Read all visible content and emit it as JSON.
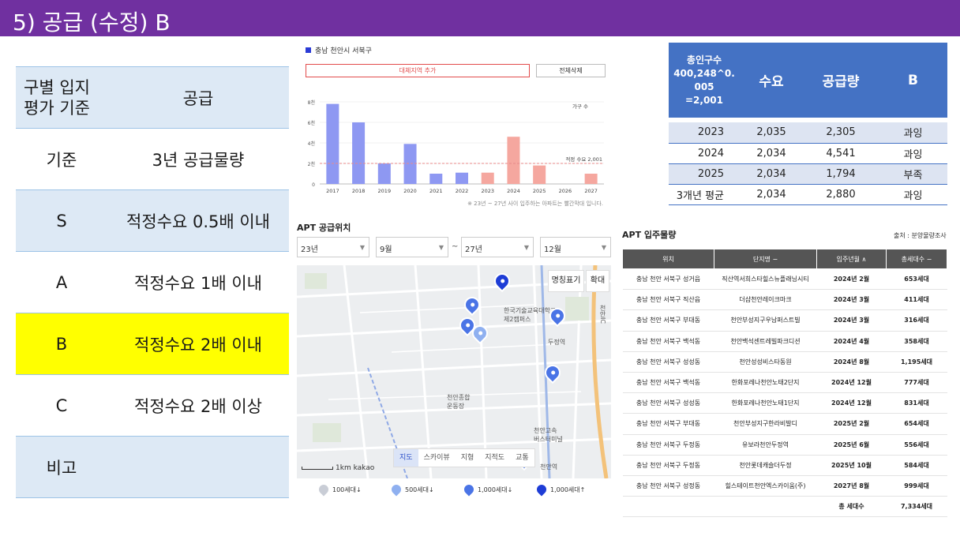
{
  "title": "5) 공급 (수정) B",
  "criteria": {
    "header": [
      "구별 입지\n평가 기준",
      "공급"
    ],
    "rows": [
      {
        "label": "기준",
        "value": "3년 공급물량"
      },
      {
        "label": "S",
        "value": "적정수요 0.5배 이내"
      },
      {
        "label": "A",
        "value": "적정수요 1배 이내"
      },
      {
        "label": "B",
        "value": "적정수요 2배 이내"
      },
      {
        "label": "C",
        "value": "적정수요 2배 이상"
      },
      {
        "label": "비고",
        "value": ""
      }
    ]
  },
  "chart_panel": {
    "region": "충남 천안시 서북구",
    "add_button": "대체지역 추가",
    "delete_button": "전체삭제",
    "note": "※ 23년 ~ 27년 사이 입주하는 아파트는 빨간막대 입니다."
  },
  "chart_data": {
    "type": "bar",
    "categories": [
      "2017",
      "2018",
      "2019",
      "2020",
      "2021",
      "2022",
      "2023",
      "2024",
      "2025",
      "2026",
      "2027"
    ],
    "values": [
      7800,
      6000,
      2000,
      3900,
      1000,
      1100,
      1100,
      4600,
      1800,
      0,
      1000
    ],
    "ylim": [
      0,
      8000
    ],
    "yticks": [
      "0",
      "2천",
      "4천",
      "6천",
      "8천"
    ],
    "legend": "가구 수",
    "reference_line": {
      "value": 2001,
      "label": "적정 수요 2,001"
    },
    "colors": {
      "past": "#8e98f2",
      "future": "#f5a79f",
      "ref": "#e88a8a"
    }
  },
  "map_panel": {
    "title": "APT 공급위치",
    "selects": [
      "23년",
      "9월",
      "27년",
      "12월"
    ],
    "tilde": "~",
    "buttons": {
      "names": "명칭표기",
      "zoom": "확대"
    },
    "tabs": [
      "지도",
      "스카이뷰",
      "지형",
      "지적도",
      "교통"
    ],
    "scale": "1km",
    "brand": "kakao",
    "labels": [
      "한국기술교육대학교\n제2캠퍼스",
      "두정역",
      "천안종합\n운동장",
      "천안고속\n버스터미널",
      "천안역",
      "천안IC"
    ],
    "legend": [
      "100세대↓",
      "500세대↓",
      "1,000세대↓",
      "1,000세대↑"
    ]
  },
  "demand_table": {
    "header": [
      "총인구수\n400,248^0.\n005\n=2,001",
      "수요",
      "공급량",
      "B"
    ],
    "rows": [
      [
        "2023",
        "2,035",
        "2,305",
        "과잉"
      ],
      [
        "2024",
        "2,034",
        "4,541",
        "과잉"
      ],
      [
        "2025",
        "2,034",
        "1,794",
        "부족"
      ],
      [
        "3개년 평균",
        "2,034",
        "2,880",
        "과잉"
      ]
    ]
  },
  "move_in": {
    "title": "APT 입주물량",
    "source": "출처 : 분양물량조사",
    "columns": [
      "위치",
      "단지명 −",
      "입주년월 ∧",
      "총세대수 −"
    ],
    "rows": [
      [
        "충남 천안 서북구 성거읍",
        "직산역서희스타힐스뉴플래닝시티",
        "2024년 2월",
        "653세대"
      ],
      [
        "충남 천안 서북구 직산읍",
        "더샵천안레이크마크",
        "2024년 3월",
        "411세대"
      ],
      [
        "충남 천안 서북구 부대동",
        "천안부성지구우남퍼스트빌",
        "2024년 3월",
        "316세대"
      ],
      [
        "충남 천안 서북구 백석동",
        "천안백석센트레빌파크디션",
        "2024년 4월",
        "358세대"
      ],
      [
        "충남 천안 서북구 성성동",
        "천안성성비스타동원",
        "2024년 8월",
        "1,195세대"
      ],
      [
        "충남 천안 서북구 백석동",
        "한화포레나천안노태2단지",
        "2024년 12월",
        "777세대"
      ],
      [
        "충남 천안 서북구 성성동",
        "한화포레나천안노태1단지",
        "2024년 12월",
        "831세대"
      ],
      [
        "충남 천안 서북구 부대동",
        "천안부성지구한라비발디",
        "2025년 2월",
        "654세대"
      ],
      [
        "충남 천안 서북구 두정동",
        "유보라천안두정역",
        "2025년 6월",
        "556세대"
      ],
      [
        "충남 천안 서북구 두정동",
        "천안롯데캐슬더두정",
        "2025년 10월",
        "584세대"
      ],
      [
        "충남 천안 서북구 성정동",
        "힐스테이트천안엑스카이움(주)",
        "2027년 8월",
        "999세대"
      ]
    ],
    "total_label": "총 세대수",
    "total_value": "7,334세대"
  }
}
